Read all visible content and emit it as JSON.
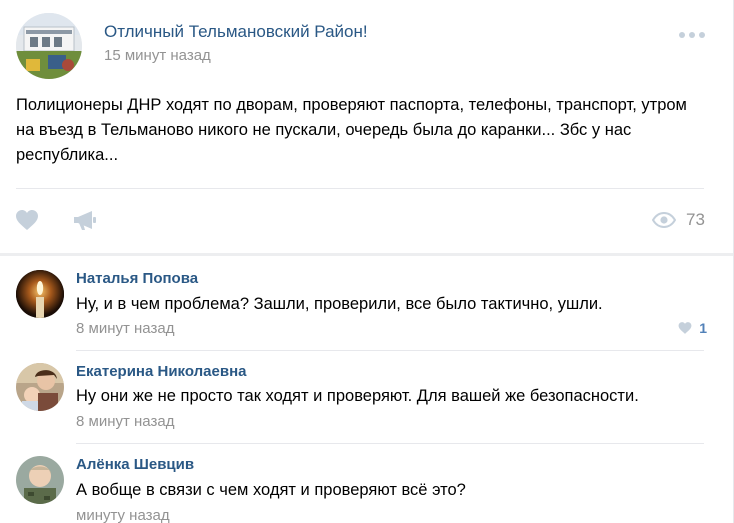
{
  "post": {
    "group_name": "Отличный Тельмановский Район!",
    "time": "15 минут назад",
    "text": "Полиционеры ДНР ходят по дворам, проверяют паспорта, телефоны, транспорт, утром на въезд в Тельманово никого не пускали, очередь была до каранки... Збс у нас республика...",
    "avatar_icon": "group-avatar-image",
    "more_icon": "ellipsis-icon",
    "like_icon": "heart-icon",
    "share_icon": "megaphone-icon",
    "views_icon": "eye-icon",
    "views_count": "73"
  },
  "comments": [
    {
      "author": "Наталья Попова",
      "text": "Ну, и в чем проблема? Зашли, проверили, все было тактично, ушли.",
      "time": "8 минут назад",
      "likes": "1",
      "avatar_icon": "candle-avatar-image"
    },
    {
      "author": "Екатерина Николаевна",
      "text": "Ну они же не просто так ходят и проверяют. Для вашей же безопасности.",
      "time": "8 минут назад",
      "avatar_icon": "user-photo-avatar"
    },
    {
      "author": "Алёнка Шевцив",
      "text": "А вобще в связи с чем ходят и проверяют всё это?",
      "time": "минуту назад",
      "avatar_icon": "child-photo-avatar"
    }
  ],
  "colors": {
    "link": "#2a5885",
    "meta": "#939393",
    "icon": "#c5d0db",
    "like_active": "#5181b8",
    "divider": "#e7e8ec"
  }
}
